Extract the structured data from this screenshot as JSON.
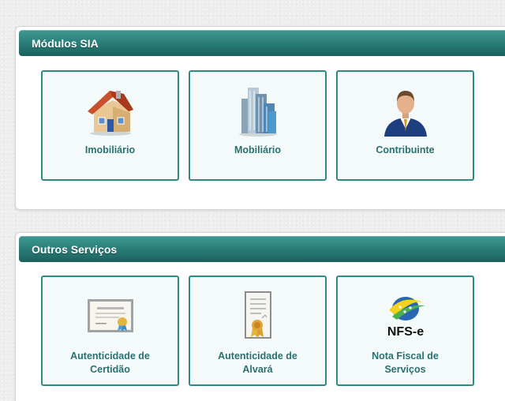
{
  "modulos": {
    "title": "Módulos SIA",
    "tiles": [
      {
        "label": "Imobiliário",
        "icon": "house-icon"
      },
      {
        "label": "Mobiliário",
        "icon": "buildings-icon"
      },
      {
        "label": "Contribuinte",
        "icon": "businessman-icon"
      }
    ]
  },
  "outros": {
    "title": "Outros Serviços",
    "tiles": [
      {
        "label_line1": "Autenticidade de",
        "label_line2": "Certidão",
        "icon": "certificate-icon"
      },
      {
        "label_line1": "Autenticidade de",
        "label_line2": "Alvará",
        "icon": "license-document-icon"
      },
      {
        "label_line1": "Nota Fiscal de",
        "label_line2": "Serviços",
        "icon": "nfse-logo-icon",
        "logo_text": "NFS-e"
      }
    ]
  },
  "colors": {
    "header": "#2a7d78",
    "tile_border": "#2f8a83",
    "tile_bg": "#f4fafa",
    "label": "#2a7070"
  }
}
